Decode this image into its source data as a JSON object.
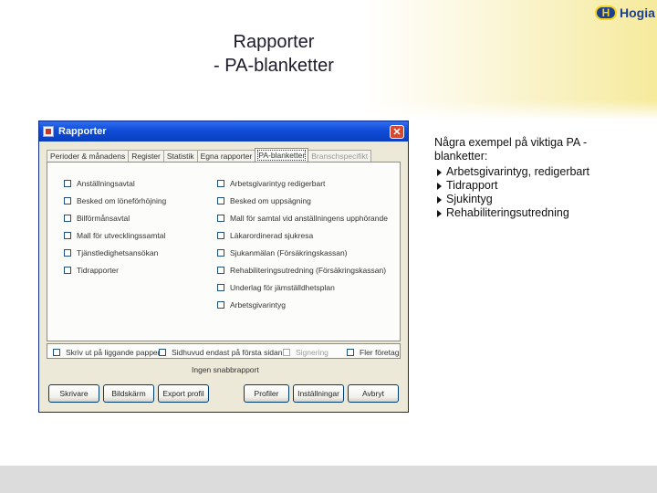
{
  "slide": {
    "title_line1": "Rapporter",
    "title_line2": "- PA-blanketter",
    "logo_mark": "H",
    "logo_text": "Hogia",
    "bullets_intro": "Några exempel på viktiga PA -blanketter:",
    "bullets": [
      "Arbetsgivarintyg, redigerbart",
      "Tidrapport",
      "Sjukintyg",
      "Rehabiliteringsutredning"
    ]
  },
  "dialog": {
    "title": "Rapporter",
    "close_glyph": "✕",
    "tabs": [
      "Perioder & månadens",
      "Register",
      "Statistik",
      "Egna rapporter",
      "PA-blanketter",
      "Branschspecifikt"
    ],
    "active_tab_index": 4,
    "left_checkboxes": [
      "Anställningsavtal",
      "Besked om löneförhöjning",
      "Bilförmånsavtal",
      "Mall för utvecklingssamtal",
      "Tjänstledighetsansökan",
      "Tidrapporter"
    ],
    "right_checkboxes": [
      "Arbetsgivarintyg redigerbart",
      "Besked om uppsägning",
      "Mall för samtal vid anställningens upphörande",
      "Läkarordinerad sjukresa",
      "Sjukanmälan (Försäkringskassan)",
      "Rehabiliteringsutredning (Försäkringskassan)",
      "Underlag för jämställdhetsplan",
      "Arbetsgivarintyg"
    ],
    "options": {
      "skriv_label": "Skriv ut på liggande papper",
      "sidhuvud_label": "Sidhuvud endast på första sidan",
      "signering_label": "Signering",
      "flera_label": "Fler företag"
    },
    "trigger_label": "Ingen snabbrapport",
    "buttons": {
      "skrivare": "Skrivare",
      "bildskarm": "Bildskärm",
      "export": "Export profil",
      "profiler": "Profiler",
      "installningar": "Inställningar",
      "avbryt": "Avbryt"
    }
  }
}
